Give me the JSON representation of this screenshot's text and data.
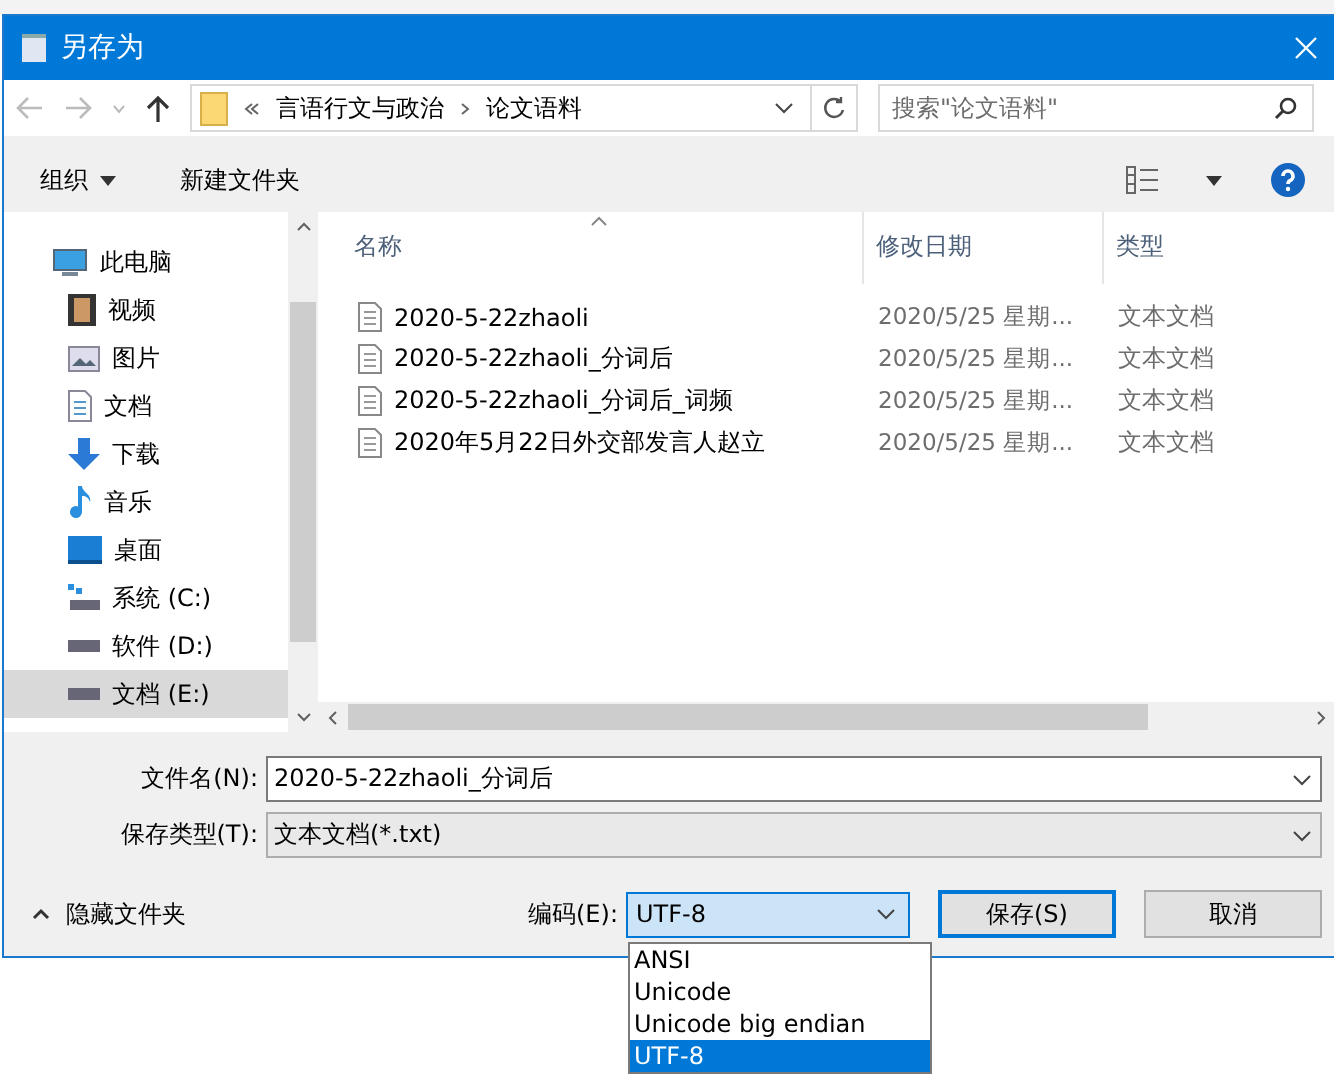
{
  "window": {
    "title": "另存为"
  },
  "address": {
    "path": [
      "言语行文与政治",
      "论文语料"
    ]
  },
  "search": {
    "placeholder": "搜索\"论文语料\""
  },
  "toolbar": {
    "buttons": [
      {
        "label": "组织",
        "kind": "menu"
      },
      {
        "label": "新建文件夹",
        "kind": "plain"
      }
    ]
  },
  "nav": {
    "items": [
      {
        "label": "此电脑",
        "kind": "pc",
        "selected": false,
        "children": [
          {
            "label": "视频",
            "kind": "video",
            "selected": false
          },
          {
            "label": "图片",
            "kind": "picture",
            "selected": false
          },
          {
            "label": "文档",
            "kind": "document",
            "selected": false
          },
          {
            "label": "下载",
            "kind": "download",
            "selected": false
          },
          {
            "label": "音乐",
            "kind": "music",
            "selected": false
          },
          {
            "label": "桌面",
            "kind": "desktop",
            "selected": false
          },
          {
            "label": "系统 (C:)",
            "kind": "system-drive",
            "selected": false
          },
          {
            "label": "软件 (D:)",
            "kind": "drive",
            "selected": false
          },
          {
            "label": "文档 (E:)",
            "kind": "drive",
            "selected": true
          }
        ]
      }
    ]
  },
  "table": {
    "columns": [
      {
        "label": "名称",
        "sorted": true
      },
      {
        "label": "修改日期",
        "sorted": false
      },
      {
        "label": "类型",
        "sorted": false
      }
    ],
    "rows": [
      {
        "name": "2020-5-22zhaoli",
        "date": "2020/5/25 星期...",
        "type": "文本文档"
      },
      {
        "name": "2020-5-22zhaoli_分词后",
        "date": "2020/5/25 星期...",
        "type": "文本文档"
      },
      {
        "name": "2020-5-22zhaoli_分词后_词频",
        "date": "2020/5/25 星期...",
        "type": "文本文档"
      },
      {
        "name": "2020年5月22日外交部发言人赵立",
        "date": "2020/5/25 星期...",
        "type": "文本文档"
      }
    ]
  },
  "filename": {
    "label": "文件名(N):",
    "value": "2020-5-22zhaoli_分词后"
  },
  "filetype": {
    "label": "保存类型(T):",
    "value": "文本文档(*.txt)"
  },
  "hide_folders": "隐藏文件夹",
  "encoding": {
    "label": "编码(E):",
    "value": "UTF-8",
    "expanded": true,
    "options": [
      {
        "label": "ANSI",
        "selected": false
      },
      {
        "label": "Unicode",
        "selected": false
      },
      {
        "label": "Unicode big endian",
        "selected": false
      },
      {
        "label": "UTF-8",
        "selected": true
      }
    ]
  },
  "buttons": [
    {
      "label": "保存(S)",
      "kind": "default"
    },
    {
      "label": "取消",
      "kind": "normal"
    }
  ]
}
